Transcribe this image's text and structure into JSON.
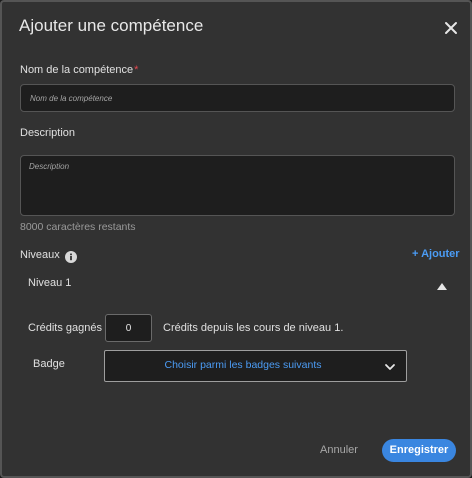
{
  "dialog": {
    "title": "Ajouter une compétence"
  },
  "name_field": {
    "label": "Nom de la compétence",
    "required_mark": "*",
    "placeholder": "Nom de la compétence",
    "value": ""
  },
  "description_field": {
    "label": "Description",
    "placeholder": "Description",
    "value": "",
    "chars_remaining": "8000 caractères restants"
  },
  "levels": {
    "label": "Niveaux",
    "add_label": "+ Ajouter",
    "items": [
      {
        "title": "Niveau 1",
        "credits_label": "Crédits gagnés",
        "credits_value": "0",
        "credits_hint": "Crédits depuis les cours de niveau 1.",
        "badge_label": "Badge",
        "badge_select_text": "Choisir parmi les badges suivants"
      }
    ]
  },
  "footer": {
    "cancel_label": "Annuler",
    "save_label": "Enregistrer"
  },
  "colors": {
    "accent": "#3a86e0",
    "link": "#4b9cf5",
    "required": "#e34850",
    "background": "#323232"
  },
  "icons": [
    "close-icon",
    "info-icon",
    "chevron-up-icon",
    "chevron-down-icon"
  ]
}
